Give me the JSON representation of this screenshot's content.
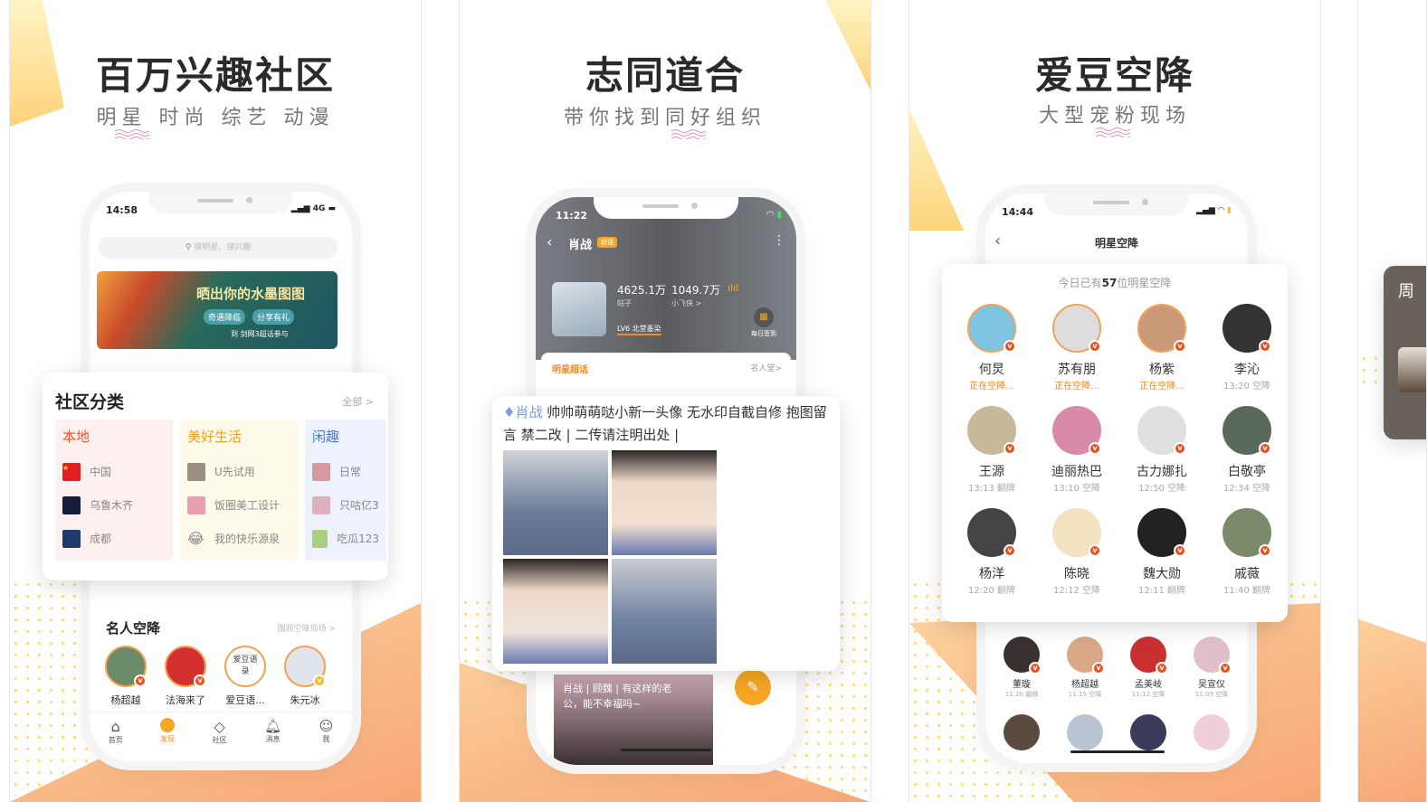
{
  "panels": [
    {
      "title": "百万兴趣社区",
      "subtitle": "明星 时尚 综艺 动漫",
      "phone": {
        "time": "14:58",
        "network": "4G",
        "search_placeholder": "搜明星、搜兴趣",
        "banner": {
          "headline": "晒出你的水墨图图",
          "tags": [
            "奇遇降临",
            "分享有礼"
          ],
          "footer": "到 剑网3超话参与"
        },
        "section_celeb": {
          "title": "名人空降",
          "link": "围观空降现场 >"
        },
        "celebs": [
          "杨超越",
          "法海来了",
          "爱豆语...",
          "朱元冰"
        ],
        "celeb_text_avatar": "爱豆语录",
        "tabbar": [
          {
            "label": "首页",
            "icon": "home-icon"
          },
          {
            "label": "发现",
            "icon": "discover-icon",
            "active": true
          },
          {
            "label": "社区",
            "icon": "diamond-icon"
          },
          {
            "label": "消息",
            "icon": "bell-icon"
          },
          {
            "label": "我",
            "icon": "user-icon"
          }
        ]
      },
      "category_card": {
        "title": "社区分类",
        "all_link": "全部 >",
        "columns": [
          {
            "heading": "本地",
            "color": "#e8552a",
            "bg": "#fff0f0",
            "items": [
              "中国",
              "乌鲁木齐",
              "成都"
            ]
          },
          {
            "heading": "美好生活",
            "color": "#f0a020",
            "bg": "#fffbea",
            "items": [
              "U先试用",
              "饭圈美工设计",
              "我的快乐源泉"
            ]
          },
          {
            "heading": "闲趣",
            "color": "#4a78d8",
            "bg": "#eef2fc",
            "items": [
              "日常",
              "只咕亿3",
              "吃瓜123"
            ]
          }
        ]
      }
    },
    {
      "title": "志同道合",
      "subtitle": "带你找到同好组织",
      "phone": {
        "time": "11:22",
        "topic_name": "肖战",
        "topic_badge": "超话",
        "posts_count": "4625.1万",
        "posts_label": "帖子",
        "fans_count": "1049.7万",
        "fans_label": "小飞侠 >",
        "level": "LV6 北堂墨染",
        "checkin": "每日签到",
        "tab_label": "明星超话",
        "hall_link": "名人堂>",
        "post2_text": "肖战 | 顾魏 | 有这样的老公，能不幸福吗~"
      },
      "post_card": {
        "tag": "肖战",
        "text": "帅帅萌萌哒小新一头像 无水印自截自修 抱图留言 禁二改 | 二传请注明出处 |"
      }
    },
    {
      "title": "爱豆空降",
      "subtitle": "大型宠粉现场",
      "phone": {
        "time": "14:44",
        "nav_title": "明星空降",
        "more_stars": [
          {
            "name": "董璇",
            "time": "11:20 翻牌"
          },
          {
            "name": "杨超越",
            "time": "11:15 空降"
          },
          {
            "name": "孟美岐",
            "time": "11:12 空降"
          },
          {
            "name": "吴宣仪",
            "time": "11:09 空降"
          }
        ]
      },
      "stars_card": {
        "header_prefix": "今日已有",
        "header_count": "57",
        "header_suffix": "位明星空降",
        "stars": [
          {
            "name": "何炅",
            "time": "正在空降...",
            "live": true,
            "color": "#7ec3e0"
          },
          {
            "name": "苏有朋",
            "time": "正在空降...",
            "live": true,
            "color": "#ddd"
          },
          {
            "name": "杨紫",
            "time": "正在空降...",
            "live": true,
            "color": "#c89a7a"
          },
          {
            "name": "李沁",
            "time": "13:20 空降",
            "live": false,
            "color": "#333"
          },
          {
            "name": "王源",
            "time": "13:13 翻牌",
            "live": false,
            "color": "#c8b89a"
          },
          {
            "name": "迪丽热巴",
            "time": "13:10 空降",
            "live": false,
            "color": "#d88aa8"
          },
          {
            "name": "古力娜扎",
            "time": "12:50 空降",
            "live": false,
            "color": "#e0e0e0"
          },
          {
            "name": "白敬亭",
            "time": "12:34 空降",
            "live": false,
            "color": "#5a6a5a"
          },
          {
            "name": "杨洋",
            "time": "12:20 翻牌",
            "live": false,
            "color": "#444"
          },
          {
            "name": "陈晓",
            "time": "12:12 空降",
            "live": false,
            "color": "#f3e3c0"
          },
          {
            "name": "魏大勋",
            "time": "12:11 翻牌",
            "live": false,
            "color": "#222"
          },
          {
            "name": "戚薇",
            "time": "11:40 翻牌",
            "live": false,
            "color": "#7a8a6a"
          }
        ]
      }
    },
    {
      "partial_text": "周"
    }
  ],
  "colors": {
    "accent": "#f08a2a",
    "badge": "#e8501e",
    "fab": "#f5a623"
  }
}
